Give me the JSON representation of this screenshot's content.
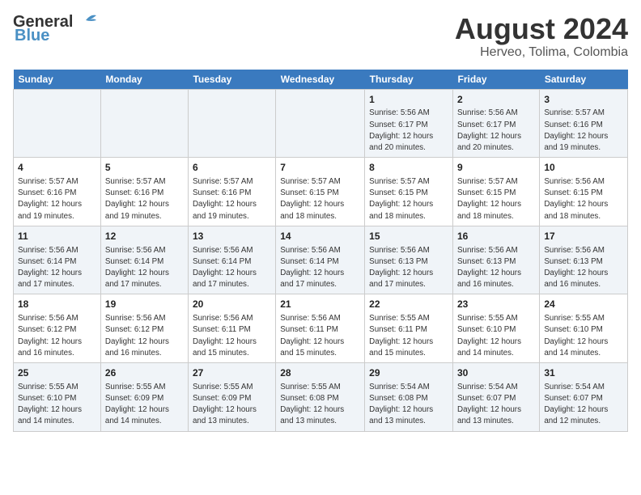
{
  "header": {
    "logo_general": "General",
    "logo_blue": "Blue",
    "month_year": "August 2024",
    "location": "Herveo, Tolima, Colombia"
  },
  "days_of_week": [
    "Sunday",
    "Monday",
    "Tuesday",
    "Wednesday",
    "Thursday",
    "Friday",
    "Saturday"
  ],
  "weeks": [
    [
      {
        "day": "",
        "info": ""
      },
      {
        "day": "",
        "info": ""
      },
      {
        "day": "",
        "info": ""
      },
      {
        "day": "",
        "info": ""
      },
      {
        "day": "1",
        "info": "Sunrise: 5:56 AM\nSunset: 6:17 PM\nDaylight: 12 hours\nand 20 minutes."
      },
      {
        "day": "2",
        "info": "Sunrise: 5:56 AM\nSunset: 6:17 PM\nDaylight: 12 hours\nand 20 minutes."
      },
      {
        "day": "3",
        "info": "Sunrise: 5:57 AM\nSunset: 6:16 PM\nDaylight: 12 hours\nand 19 minutes."
      }
    ],
    [
      {
        "day": "4",
        "info": "Sunrise: 5:57 AM\nSunset: 6:16 PM\nDaylight: 12 hours\nand 19 minutes."
      },
      {
        "day": "5",
        "info": "Sunrise: 5:57 AM\nSunset: 6:16 PM\nDaylight: 12 hours\nand 19 minutes."
      },
      {
        "day": "6",
        "info": "Sunrise: 5:57 AM\nSunset: 6:16 PM\nDaylight: 12 hours\nand 19 minutes."
      },
      {
        "day": "7",
        "info": "Sunrise: 5:57 AM\nSunset: 6:15 PM\nDaylight: 12 hours\nand 18 minutes."
      },
      {
        "day": "8",
        "info": "Sunrise: 5:57 AM\nSunset: 6:15 PM\nDaylight: 12 hours\nand 18 minutes."
      },
      {
        "day": "9",
        "info": "Sunrise: 5:57 AM\nSunset: 6:15 PM\nDaylight: 12 hours\nand 18 minutes."
      },
      {
        "day": "10",
        "info": "Sunrise: 5:56 AM\nSunset: 6:15 PM\nDaylight: 12 hours\nand 18 minutes."
      }
    ],
    [
      {
        "day": "11",
        "info": "Sunrise: 5:56 AM\nSunset: 6:14 PM\nDaylight: 12 hours\nand 17 minutes."
      },
      {
        "day": "12",
        "info": "Sunrise: 5:56 AM\nSunset: 6:14 PM\nDaylight: 12 hours\nand 17 minutes."
      },
      {
        "day": "13",
        "info": "Sunrise: 5:56 AM\nSunset: 6:14 PM\nDaylight: 12 hours\nand 17 minutes."
      },
      {
        "day": "14",
        "info": "Sunrise: 5:56 AM\nSunset: 6:14 PM\nDaylight: 12 hours\nand 17 minutes."
      },
      {
        "day": "15",
        "info": "Sunrise: 5:56 AM\nSunset: 6:13 PM\nDaylight: 12 hours\nand 17 minutes."
      },
      {
        "day": "16",
        "info": "Sunrise: 5:56 AM\nSunset: 6:13 PM\nDaylight: 12 hours\nand 16 minutes."
      },
      {
        "day": "17",
        "info": "Sunrise: 5:56 AM\nSunset: 6:13 PM\nDaylight: 12 hours\nand 16 minutes."
      }
    ],
    [
      {
        "day": "18",
        "info": "Sunrise: 5:56 AM\nSunset: 6:12 PM\nDaylight: 12 hours\nand 16 minutes."
      },
      {
        "day": "19",
        "info": "Sunrise: 5:56 AM\nSunset: 6:12 PM\nDaylight: 12 hours\nand 16 minutes."
      },
      {
        "day": "20",
        "info": "Sunrise: 5:56 AM\nSunset: 6:11 PM\nDaylight: 12 hours\nand 15 minutes."
      },
      {
        "day": "21",
        "info": "Sunrise: 5:56 AM\nSunset: 6:11 PM\nDaylight: 12 hours\nand 15 minutes."
      },
      {
        "day": "22",
        "info": "Sunrise: 5:55 AM\nSunset: 6:11 PM\nDaylight: 12 hours\nand 15 minutes."
      },
      {
        "day": "23",
        "info": "Sunrise: 5:55 AM\nSunset: 6:10 PM\nDaylight: 12 hours\nand 14 minutes."
      },
      {
        "day": "24",
        "info": "Sunrise: 5:55 AM\nSunset: 6:10 PM\nDaylight: 12 hours\nand 14 minutes."
      }
    ],
    [
      {
        "day": "25",
        "info": "Sunrise: 5:55 AM\nSunset: 6:10 PM\nDaylight: 12 hours\nand 14 minutes."
      },
      {
        "day": "26",
        "info": "Sunrise: 5:55 AM\nSunset: 6:09 PM\nDaylight: 12 hours\nand 14 minutes."
      },
      {
        "day": "27",
        "info": "Sunrise: 5:55 AM\nSunset: 6:09 PM\nDaylight: 12 hours\nand 13 minutes."
      },
      {
        "day": "28",
        "info": "Sunrise: 5:55 AM\nSunset: 6:08 PM\nDaylight: 12 hours\nand 13 minutes."
      },
      {
        "day": "29",
        "info": "Sunrise: 5:54 AM\nSunset: 6:08 PM\nDaylight: 12 hours\nand 13 minutes."
      },
      {
        "day": "30",
        "info": "Sunrise: 5:54 AM\nSunset: 6:07 PM\nDaylight: 12 hours\nand 13 minutes."
      },
      {
        "day": "31",
        "info": "Sunrise: 5:54 AM\nSunset: 6:07 PM\nDaylight: 12 hours\nand 12 minutes."
      }
    ]
  ]
}
